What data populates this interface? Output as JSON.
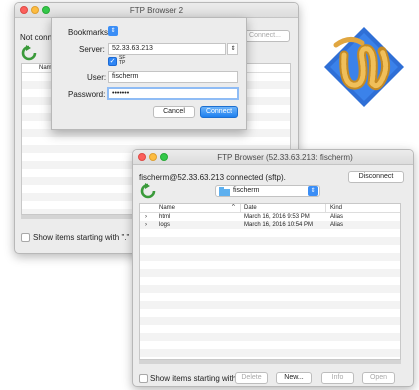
{
  "back_window": {
    "title": "FTP Browser 2",
    "status": "Not connected",
    "connect_button": "Connect...",
    "column_name": "Name",
    "show_hidden_label": "Show items starting with \".\""
  },
  "sheet": {
    "bookmarks_label": "Bookmarks:",
    "server_label": "Server:",
    "server_value": "52.33.63.213",
    "sftp_label": "SFTP",
    "user_label": "User:",
    "user_value": "fischerm",
    "password_label": "Password:",
    "password_value": "•••••••",
    "cancel_label": "Cancel",
    "connect_label": "Connect"
  },
  "front_window": {
    "title": "FTP Browser (52.33.63.213: fischerm)",
    "status": "fischerm@52.33.63.213 connected (sftp).",
    "disconnect_label": "Disconnect",
    "folder_value": "fischerm",
    "columns": {
      "name": "Name",
      "date": "Date",
      "kind": "Kind"
    },
    "rows": [
      {
        "name": "html",
        "date": "March 16, 2016 9:53 PM",
        "kind": "Alias"
      },
      {
        "name": "logs",
        "date": "March 16, 2016 10:54 PM",
        "kind": "Alias"
      }
    ],
    "show_hidden_label": "Show items starting with \".\"",
    "delete_label": "Delete",
    "new_label": "New...",
    "info_label": "Info",
    "open_label": "Open"
  },
  "icons": {
    "refresh": "refresh-icon",
    "folder": "folder-icon",
    "app_logo": "rope-logo-icon"
  },
  "colors": {
    "accent": "#2f86f5",
    "refresh_green": "#3a9a3a",
    "logo_blue": "#2f6fd6",
    "logo_rope": "#e0a640"
  }
}
